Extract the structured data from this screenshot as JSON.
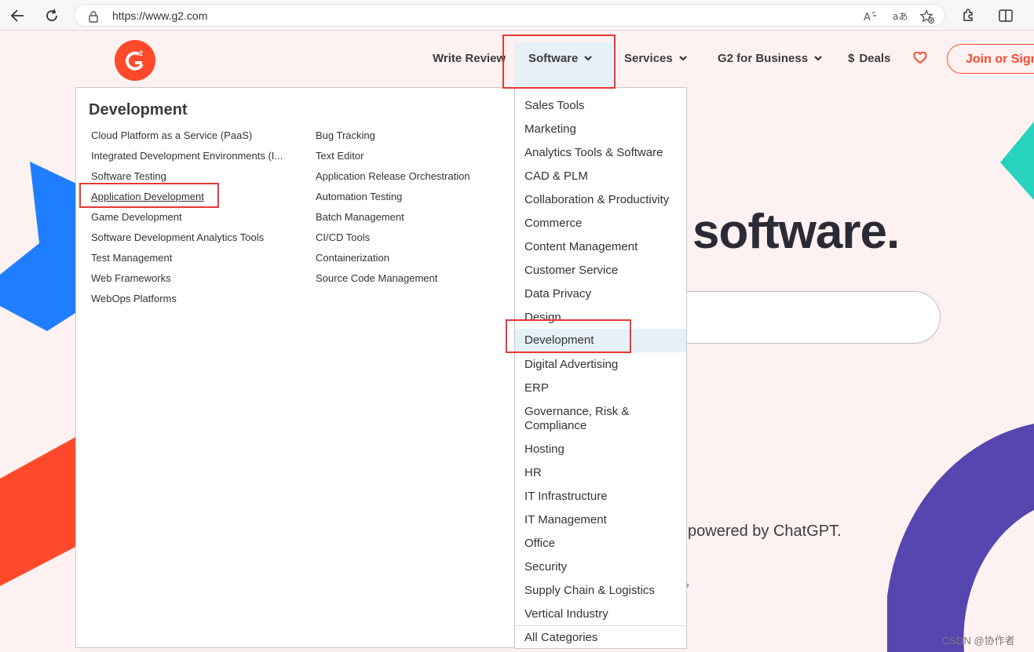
{
  "browser": {
    "url": "https://www.g2.com"
  },
  "nav": {
    "logo_text": "G2",
    "write_review": "Write Review",
    "software": "Software",
    "services": "Services",
    "g2_business": "G2 for Business",
    "deals": "Deals",
    "deals_symbol": "$",
    "join": "Join or Sign"
  },
  "hero": {
    "headline_fragment": "software.",
    "powered_fragment": "powered by ChatGPT.",
    "chevron": "›"
  },
  "mega": {
    "title": "Development",
    "col1": [
      "Cloud Platform as a Service (PaaS)",
      "Integrated Development Environments (I...",
      "Software Testing",
      "Application Development",
      "Game Development",
      "Software Development Analytics Tools",
      "Test Management",
      "Web Frameworks",
      "WebOps Platforms"
    ],
    "col2": [
      "Bug Tracking",
      "Text Editor",
      "Application Release Orchestration",
      "Automation Testing",
      "Batch Management",
      "CI/CD Tools",
      "Containerization",
      "Source Code Management"
    ]
  },
  "categories": [
    "Sales Tools",
    "Marketing",
    "Analytics Tools & Software",
    "CAD & PLM",
    "Collaboration & Productivity",
    "Commerce",
    "Content Management",
    "Customer Service",
    "Data Privacy",
    "Design",
    "Development",
    "Digital Advertising",
    "ERP",
    "Governance, Risk &",
    "Compliance",
    "Hosting",
    "HR",
    "IT Infrastructure",
    "IT Management",
    "Office",
    "Security",
    "Supply Chain & Logistics",
    "Vertical Industry",
    "All Categories"
  ],
  "watermark": "CSDN @协作者",
  "colors": {
    "brand": "#ff492c",
    "page_bg": "#fdf2f1",
    "highlight": "#e6f0f7",
    "annotation": "#e53935"
  }
}
